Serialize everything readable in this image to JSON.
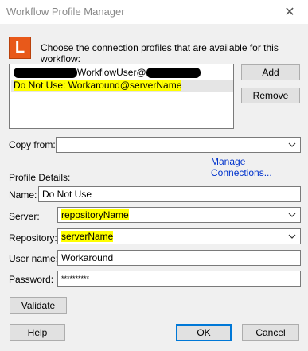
{
  "window": {
    "title": "Workflow Profile Manager",
    "close_glyph": "✕"
  },
  "app_icon": {
    "letter": "L",
    "color": "#e8591a"
  },
  "instruction": "Choose the connection profiles that are available for this workflow:",
  "profile_list": {
    "items": [
      {
        "text": "WorkflowUser@",
        "redacted": true
      },
      {
        "text": "Do Not Use: Workaround@serverName",
        "highlighted": true
      }
    ]
  },
  "buttons": {
    "add": "Add",
    "remove": "Remove",
    "validate": "Validate",
    "help": "Help",
    "ok": "OK",
    "cancel": "Cancel"
  },
  "copy_from": {
    "label": "Copy from:",
    "value": ""
  },
  "manage_connections": "Manage Connections...",
  "profile_details": {
    "heading": "Profile Details:",
    "name": {
      "label": "Name:",
      "value": "Do Not Use"
    },
    "server": {
      "label": "Server:",
      "value": "repositoryName"
    },
    "repository": {
      "label": "Repository:",
      "value": "serverName"
    },
    "username": {
      "label": "User name:",
      "value": "Workaround"
    },
    "password": {
      "label": "Password:",
      "value": "**********"
    }
  },
  "colors": {
    "highlight": "#ffff00",
    "link": "#0033cc",
    "ok_border": "#0078d7"
  }
}
